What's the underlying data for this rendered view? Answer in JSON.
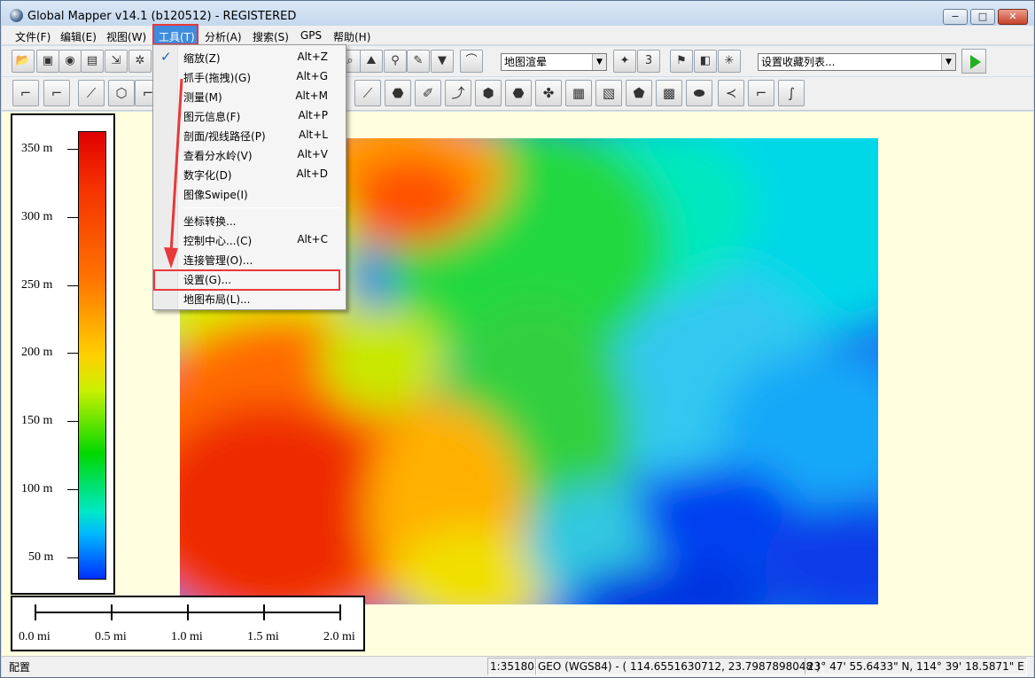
{
  "window": {
    "title": "Global Mapper v14.1 (b120512) - REGISTERED",
    "minimize": "−",
    "maximize": "□",
    "close": "✕"
  },
  "menubar": {
    "items": [
      "文件(F)",
      "编辑(E)",
      "视图(W)",
      "工具(T)",
      "分析(A)",
      "搜索(S)",
      "GPS",
      "帮助(H)"
    ]
  },
  "toolbar": {
    "render_combo": "地图渲晕",
    "favorites_combo": "设置收藏列表..."
  },
  "tools_menu": {
    "items": [
      {
        "label": "缩放(Z)",
        "shortcut": "Alt+Z",
        "checked": true
      },
      {
        "label": "抓手(拖拽)(G)",
        "shortcut": "Alt+G"
      },
      {
        "label": "测量(M)",
        "shortcut": "Alt+M"
      },
      {
        "label": "图元信息(F)",
        "shortcut": "Alt+P"
      },
      {
        "label": "剖面/视线路径(P)",
        "shortcut": "Alt+L"
      },
      {
        "label": "查看分水岭(V)",
        "shortcut": "Alt+V"
      },
      {
        "label": "数字化(D)",
        "shortcut": "Alt+D"
      },
      {
        "label": "图像Swipe(I)",
        "shortcut": ""
      },
      {
        "label": "坐标转换...",
        "shortcut": ""
      },
      {
        "label": "控制中心...(C)",
        "shortcut": "Alt+C"
      },
      {
        "label": "连接管理(O)...",
        "shortcut": ""
      },
      {
        "label": "设置(G)...",
        "shortcut": ""
      },
      {
        "label": "地图布局(L)...",
        "shortcut": ""
      }
    ],
    "check_mark": "✓"
  },
  "legend": {
    "labels": [
      "350 m",
      "300 m",
      "250 m",
      "200 m",
      "150 m",
      "100 m",
      "50 m"
    ]
  },
  "scale_bar": {
    "labels": [
      "0.0 mi",
      "0.5 mi",
      "1.0 mi",
      "1.5 mi",
      "2.0 mi"
    ]
  },
  "statusbar": {
    "left": "配置",
    "scale": "1:35180",
    "projection": "GEO (WGS84) - ( 114.6551630712, 23.7987898048 )",
    "coordinates": "23° 47' 55.6433\" N, 114° 39' 18.5871\" E"
  },
  "colors": {
    "menu_highlight": "#3f8cde",
    "annotation_red": "#e8383a",
    "map_background": "#ffffe0"
  }
}
